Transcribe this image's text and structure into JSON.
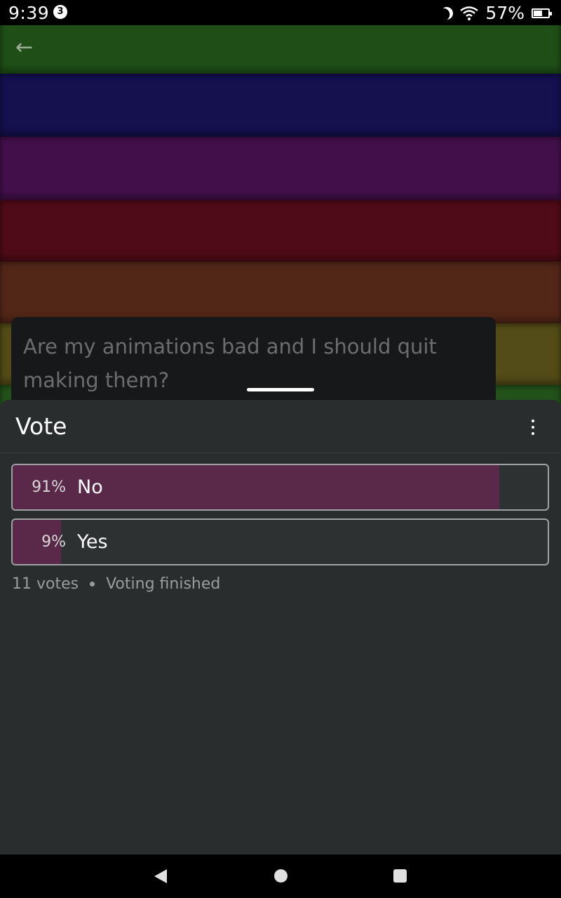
{
  "status_bar": {
    "time": "9:39",
    "notification_count": "3",
    "battery": "57%"
  },
  "question": {
    "text": "Are my animations bad and I should quit making them?"
  },
  "poll": {
    "title": "Vote",
    "options": [
      {
        "percent_label": "91%",
        "label": "No",
        "fill_fraction": 0.91
      },
      {
        "percent_label": "9%",
        "label": "Yes",
        "fill_fraction": 0.09
      }
    ],
    "votes": "11 votes",
    "status": "Voting finished"
  },
  "colors": {
    "result_fill": "#5a2848",
    "sheet_background": "#2a2d2e"
  }
}
